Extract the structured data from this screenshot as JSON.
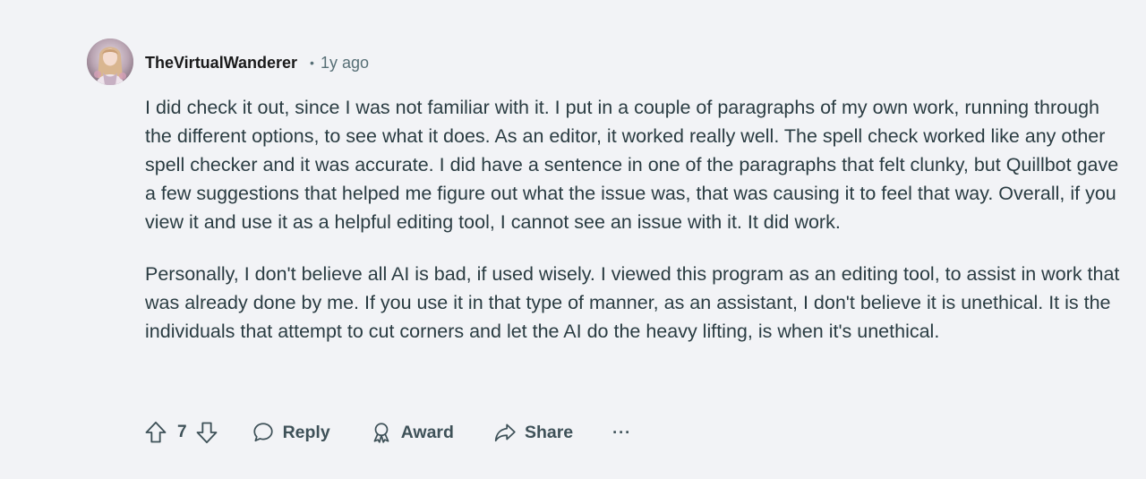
{
  "comment": {
    "author": "TheVirtualWanderer",
    "separator": "•",
    "time": "1y ago",
    "paragraphs": [
      "I did check it out, since I was not familiar with it. I put in a couple of paragraphs of my own work, running through the different options, to see what it does. As an editor, it worked really well. The spell check worked like any other spell checker and it was accurate. I did have a sentence in one of the paragraphs that felt clunky, but Quillbot gave a few suggestions that helped me figure out what the issue was, that was causing it to feel that way. Overall, if you view it and use it as a helpful editing tool, I cannot see an issue with it. It did work.",
      "Personally, I don't believe all AI is bad, if used wisely. I viewed this program as an editing tool, to assist in work that was already done by me. If you use it in that type of manner, as an assistant, I don't believe it is unethical. It is the individuals that attempt to cut corners and let the AI do the heavy lifting, is when it's unethical."
    ]
  },
  "actions": {
    "upvote_icon": "arrow-up-icon",
    "vote_count": "7",
    "downvote_icon": "arrow-down-icon",
    "reply_label": "Reply",
    "award_label": "Award",
    "share_label": "Share",
    "more_label": "···"
  },
  "colors": {
    "background": "#f2f3f6",
    "text": "#2a3c42",
    "muted": "#576f76",
    "action": "#3e5158"
  }
}
